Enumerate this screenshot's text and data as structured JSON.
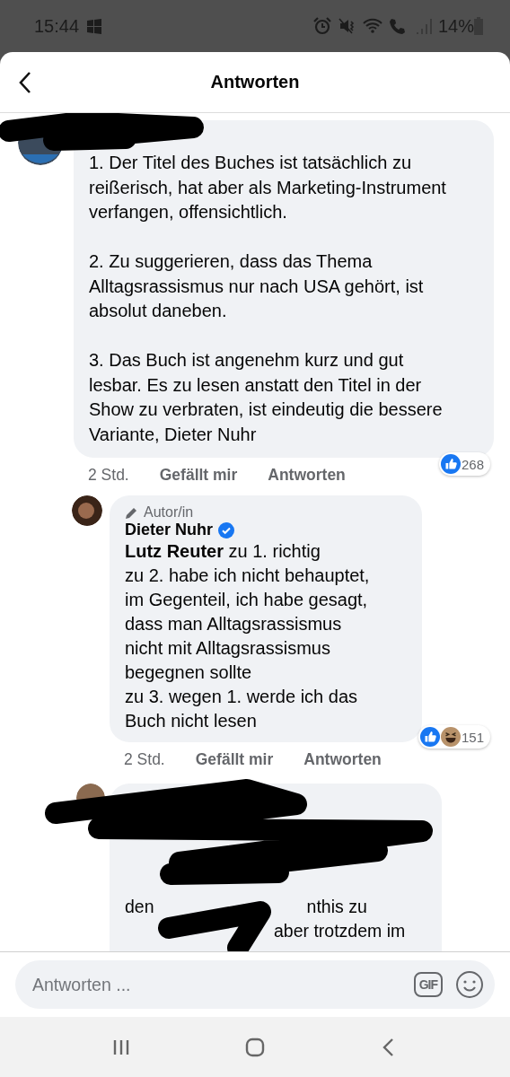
{
  "status_bar": {
    "time": "15:44",
    "battery": "14%"
  },
  "header": {
    "title": "Antworten"
  },
  "comments": [
    {
      "kind": "comment",
      "redacted": true,
      "text": "1. Der Titel des Buches ist tatsächlich zu\nreißerisch, hat aber als Marketing-Instrument\nverfangen, offensichtlich.\n\n2. Zu suggerieren, dass das Thema\nAlltagsrassismus nur nach USA gehört, ist\nabsolut daneben.\n\n3. Das Buch ist angenehm kurz und gut\nlesbar. Es zu lesen anstatt den Titel in der\nShow zu verbraten, ist eindeutig die bessere\nVariante, Dieter Nuhr",
      "time": "2 Std.",
      "actions": [
        "Gefällt mir",
        "Antworten"
      ],
      "reactions": [
        {
          "kind": "like"
        }
      ],
      "reaction_count": "268"
    },
    {
      "kind": "reply",
      "badge": "Autor/in",
      "author": "Dieter Nuhr",
      "verified": true,
      "text": "**Lutz Reuter** zu 1. richtig\nzu 2. habe ich nicht behauptet,\nim Gegenteil, ich habe gesagt,\ndass man Alltagsrassismus\nnicht mit Alltagsrassismus\nbegegnen sollte\nzu 3. wegen 1. werde ich das\nBuch nicht lesen",
      "time": "2 Std.",
      "actions": [
        "Gefällt mir",
        "Antworten"
      ],
      "reactions": [
        {
          "kind": "like"
        },
        {
          "kind": "haha"
        }
      ],
      "reaction_count": "151"
    },
    {
      "kind": "redacted_reply",
      "fragments": [
        "den",
        "nthis zu",
        "aber trotzdem im"
      ]
    }
  ],
  "composer": {
    "placeholder": "Antworten ...",
    "gif": "GIF"
  }
}
